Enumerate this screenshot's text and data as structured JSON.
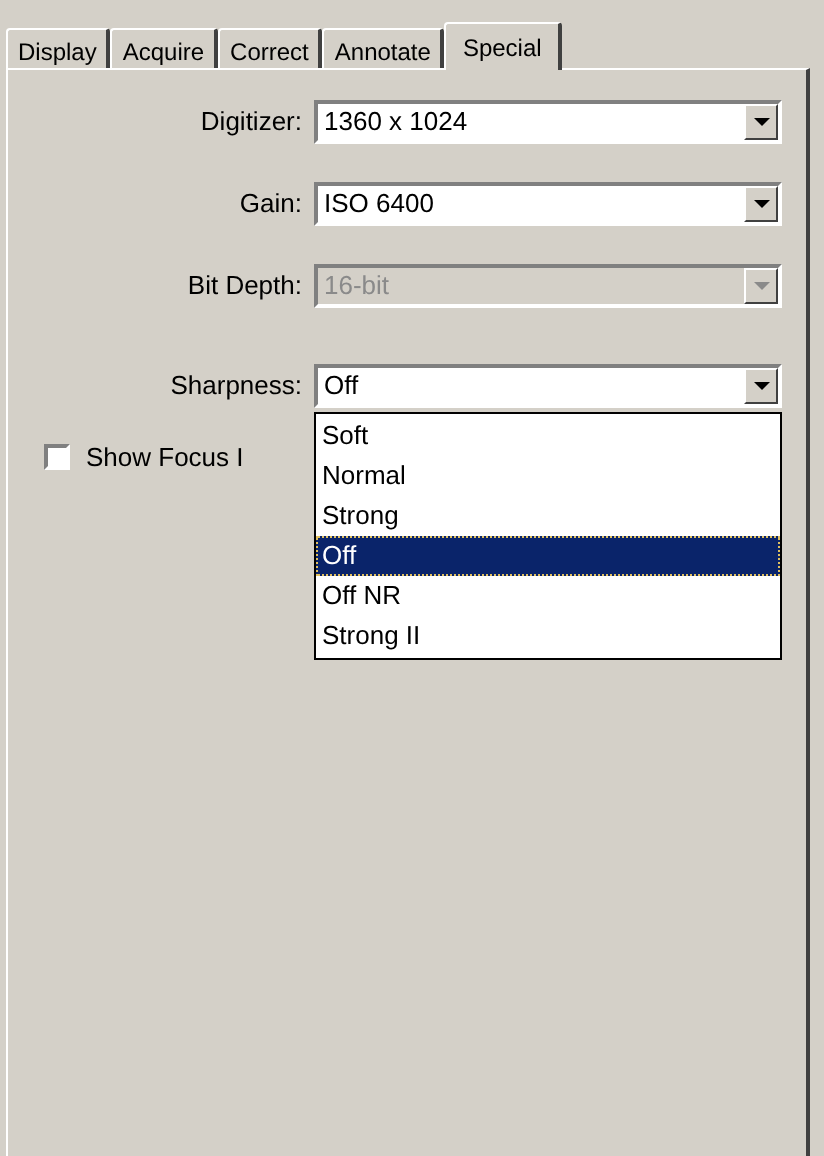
{
  "tabs": [
    {
      "label": "Display",
      "selected": false
    },
    {
      "label": "Acquire",
      "selected": false
    },
    {
      "label": "Correct",
      "selected": false
    },
    {
      "label": "Annotate",
      "selected": false
    },
    {
      "label": "Special",
      "selected": true
    }
  ],
  "fields": [
    {
      "label": "Digitizer:",
      "value": "1360 x 1024",
      "disabled": false
    },
    {
      "label": "Gain:",
      "value": "ISO 6400",
      "disabled": false
    },
    {
      "label": "Bit Depth:",
      "value": "16-bit",
      "disabled": true
    },
    {
      "label": "Sharpness:",
      "value": "Off",
      "disabled": false,
      "expanded": true
    }
  ],
  "dropdown_options": [
    {
      "label": "Soft",
      "selected": false
    },
    {
      "label": "Normal",
      "selected": false
    },
    {
      "label": "Strong",
      "selected": false
    },
    {
      "label": "Off",
      "selected": true
    },
    {
      "label": "Off NR",
      "selected": false
    },
    {
      "label": "Strong II",
      "selected": false
    }
  ],
  "checkbox": {
    "label": "Show Focus I",
    "checked": false
  }
}
